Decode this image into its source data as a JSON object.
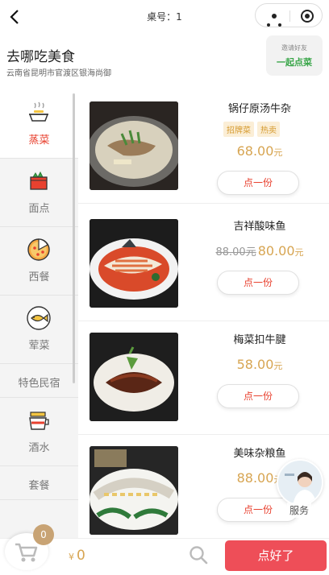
{
  "topbar": {
    "table_no": "桌号：1"
  },
  "shop": {
    "name": "去哪吃美食",
    "address": "云南省昆明市官渡区银海尚御"
  },
  "invite": {
    "line1": "邀请好友",
    "line2": "一起点菜"
  },
  "categories": [
    {
      "label": "蒸菜",
      "icon": "steamer-icon",
      "active": true
    },
    {
      "label": "面点",
      "icon": "pastry-box-icon"
    },
    {
      "label": "西餐",
      "icon": "pizza-icon"
    },
    {
      "label": "荤菜",
      "icon": "fish-plate-icon"
    },
    {
      "label": "特色民宿"
    },
    {
      "label": "酒水",
      "icon": "drink-icon"
    },
    {
      "label": "套餐"
    }
  ],
  "dishes": [
    {
      "name": "锅仔原汤牛杂",
      "tags": [
        "招牌菜",
        "热卖"
      ],
      "price": "68.00",
      "unit": "元",
      "button": "点一份"
    },
    {
      "name": "吉祥酸味鱼",
      "old_price": "88.00",
      "old_unit": "元",
      "price": "80.00",
      "unit": "元",
      "button": "点一份"
    },
    {
      "name": "梅菜扣牛腱",
      "price": "58.00",
      "unit": "元",
      "button": "点一份"
    },
    {
      "name": "美味杂粮鱼",
      "price": "88.00",
      "unit": "元",
      "button": "点一份"
    }
  ],
  "service": {
    "label": "服务"
  },
  "cart": {
    "count": "0",
    "currency": "¥",
    "total": "0"
  },
  "submit": {
    "label": "点好了"
  },
  "colors": {
    "accent_red": "#e8412f",
    "price_gold": "#d7a552",
    "submit_bg": "#ee4e58",
    "invite_green": "#3aa64a"
  }
}
